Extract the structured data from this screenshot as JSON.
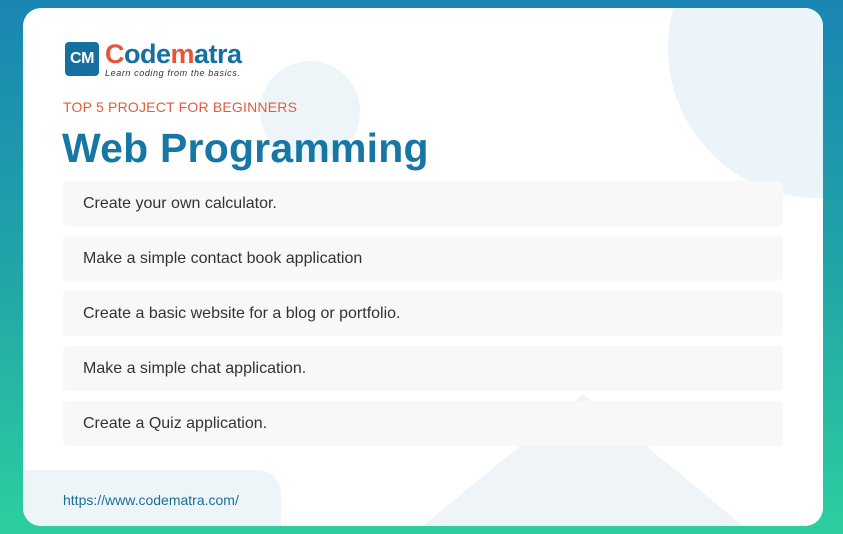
{
  "brand": {
    "mark": "CM",
    "name_parts": [
      "C",
      "ode",
      "m",
      "atra"
    ],
    "tagline": "Learn coding from the basics.",
    "colors": {
      "primary": "#1570a0",
      "accent": "#e8533a"
    }
  },
  "eyebrow": "TOP 5 PROJECT FOR BEGINNERS",
  "title": "Web Programming",
  "projects": [
    "Create your own calculator.",
    "Make a simple contact book application",
    "Create a basic website for a blog or portfolio.",
    "Make a simple chat application.",
    "Create a Quiz application."
  ],
  "footer": {
    "url": "https://www.codematra.com/"
  },
  "theme": {
    "background_top": "#1a86b3",
    "background_bottom": "#2ccf9f",
    "title_color": "#1677a5",
    "eyebrow_color": "#e55a3b"
  }
}
